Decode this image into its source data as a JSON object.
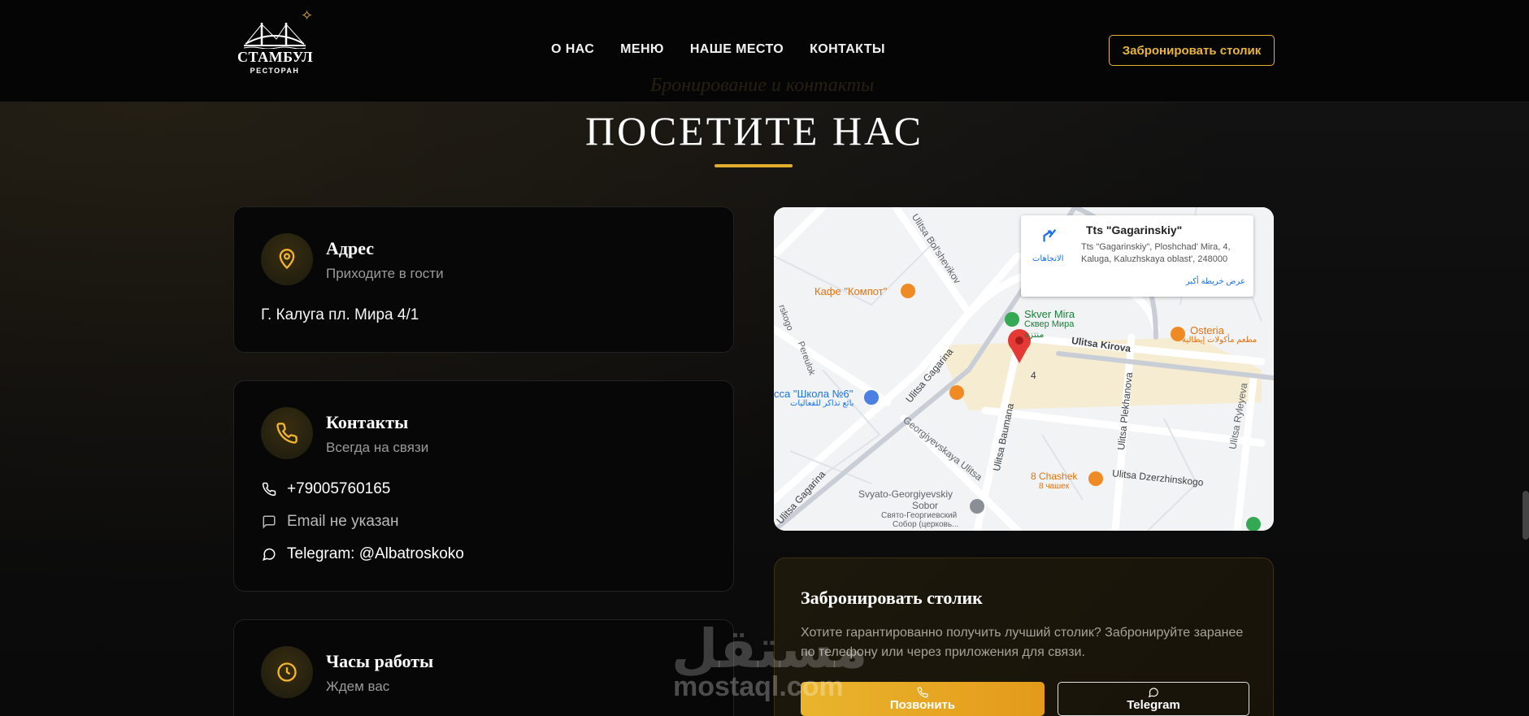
{
  "header": {
    "logo": {
      "name": "СТАМБУЛ",
      "sub": "РЕСТОРАН"
    },
    "nav": [
      "О НАС",
      "МЕНЮ",
      "НАШЕ МЕСТО",
      "КОНТАКТЫ"
    ],
    "cta": "Забронировать столик"
  },
  "section": {
    "ghost": "Бронирование и контакты",
    "title": "ПОСЕТИТЕ НАС"
  },
  "address_card": {
    "title": "Адрес",
    "subtitle": "Приходите в гости",
    "text": "Г. Калуга пл. Мира 4/1"
  },
  "contacts_card": {
    "title": "Контакты",
    "subtitle": "Всегда на связи",
    "phone": "+79005760165",
    "email": "Email не указан",
    "telegram": "Telegram: @Albatroskoko"
  },
  "hours_card": {
    "title": "Часы работы",
    "subtitle": "Ждем вас"
  },
  "map": {
    "place_title": "Tts \"Gagarinskiy\"",
    "place_address": "Tts \"Gagarinskiy\", Ploshchad' Mira, 4, Kaluga, Kaluzhskaya oblast', 248000",
    "directions": "الاتجاهات",
    "larger_map": "عرض خريطة أكبر",
    "labels": {
      "bolshevikov": "Ulitsa Bol'shevikov",
      "kompot": "Кафе \"Компот\"",
      "skver": "Skver Mira",
      "skver_ru": "Сквер Мира",
      "skver_ar": "منتزه",
      "kirova": "Ulitsa Kirova",
      "osteria": "Osteria",
      "osteria_ar": "مطعم مأكولات إيطالية",
      "gagarina": "Ulitsa Gagarina",
      "gagarina2": "Ulitsa Gagarina",
      "shkola": "сса \"Школа №6\"",
      "shkola_ar": "بائع تذاكر للفعاليات",
      "georg": "Georgiyevskaya Ulitsa",
      "baumana": "Ulitsa Baumana",
      "plekhanova": "Ulitsa Plekhanova",
      "ryleyeva": "Ulitsa Ryleyeva",
      "dzerzh": "Ulitsa Dzerzhinskogo",
      "chashek": "8 Chashek",
      "chashek_ru": "8 чашек",
      "sobor": "Svyato-Georgiyevskiy",
      "sobor2": "Sobor",
      "sobor_ru": "Свято-Георгиевский",
      "sobor_ru2": "Собор (церковь...",
      "pereulok": "Pereulok",
      "skogo": "rskogo",
      "num": "4"
    }
  },
  "booking": {
    "title": "Забронировать столик",
    "text": "Хотите гарантированно получить лучший столик? Забронируйте заранее по телефону или через приложения для связи.",
    "call": "Позвонить",
    "telegram": "Telegram"
  },
  "watermark": {
    "ar": "مستقل",
    "en": "mostaql.com"
  },
  "colors": {
    "accent": "#e2ad2c",
    "background": "#0b0b0b"
  }
}
